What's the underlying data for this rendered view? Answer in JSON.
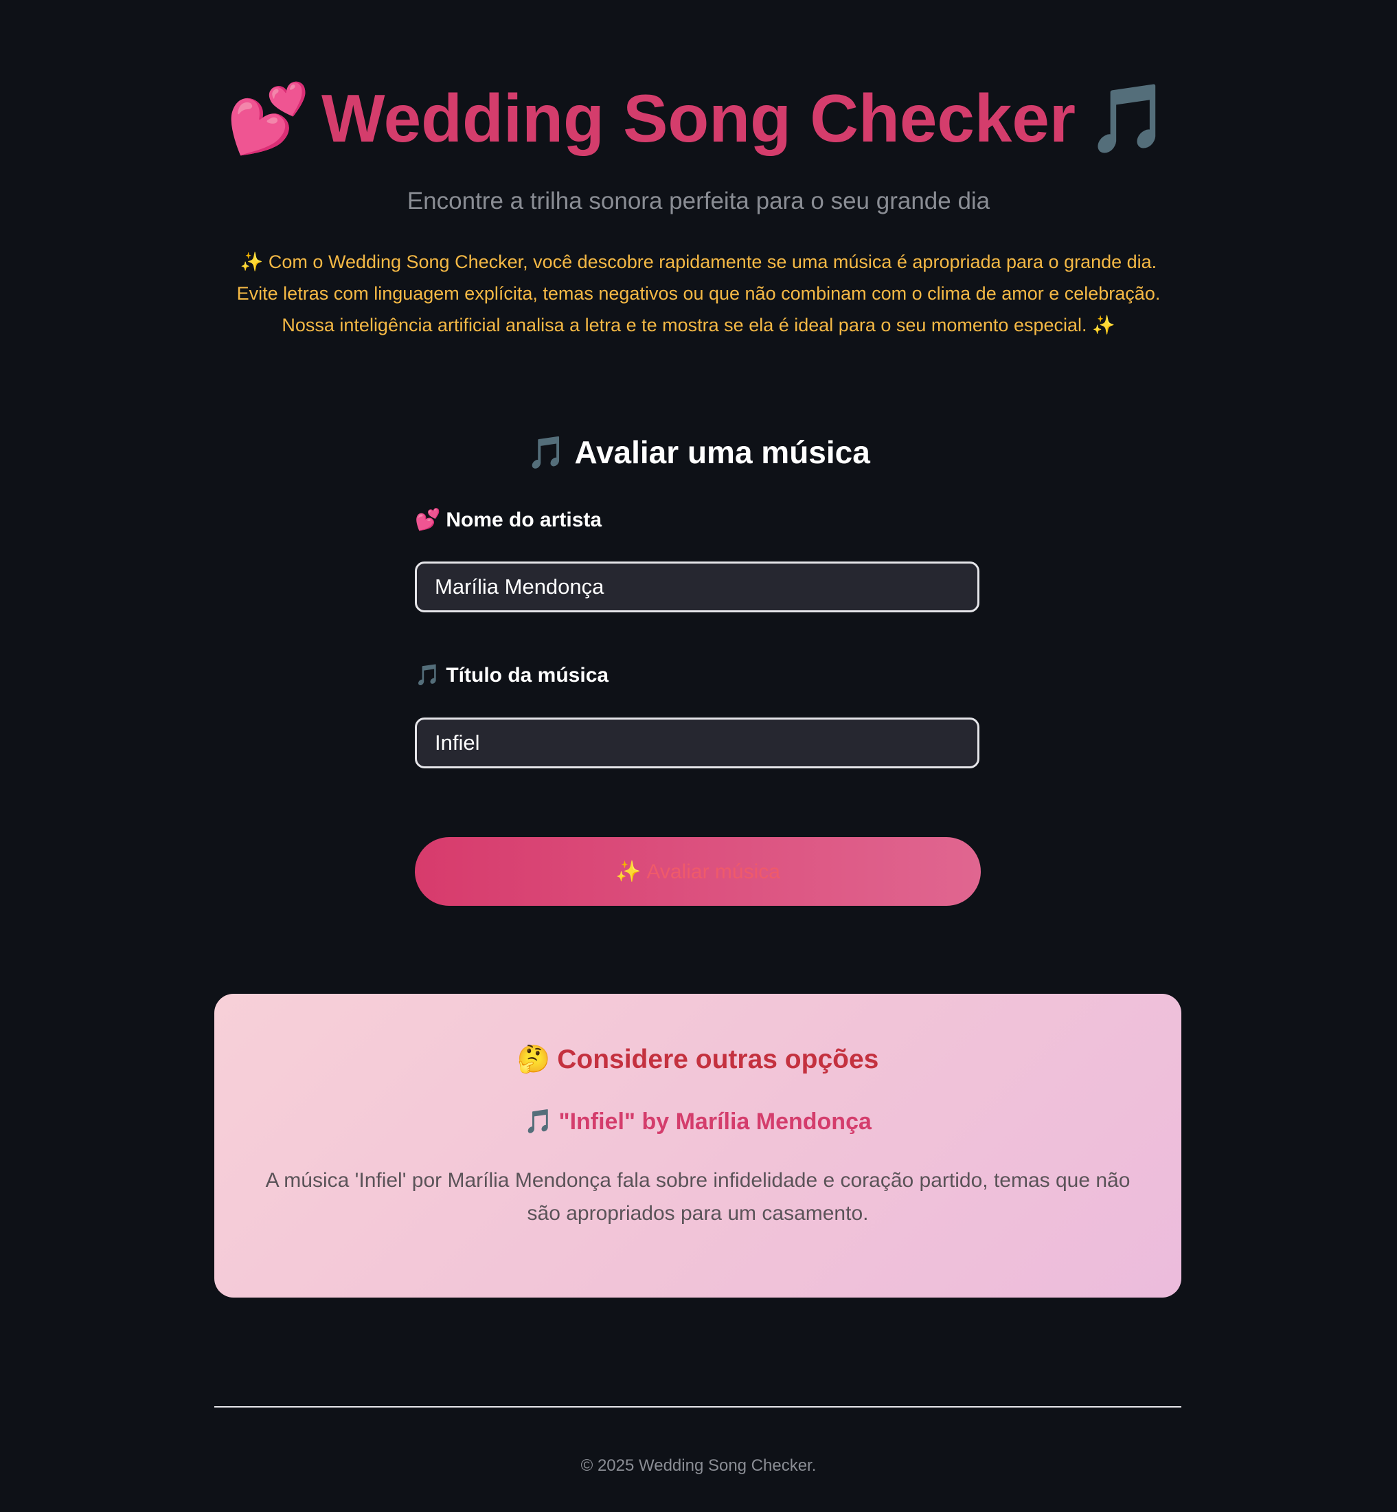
{
  "header": {
    "title_icon_left": "💕",
    "title": "Wedding Song Checker",
    "title_icon_right": "🎵",
    "subtitle": "Encontre a trilha sonora perfeita para o seu grande dia",
    "intro_lines": [
      "✨ Com o Wedding Song Checker, você descobre rapidamente se uma música é apropriada para o grande dia.",
      "Evite letras com linguagem explícita, temas negativos ou que não combinam com o clima de amor e celebração.",
      "Nossa inteligência artificial analisa a letra e te mostra se ela é ideal para o seu momento especial. ✨"
    ]
  },
  "form": {
    "heading_icon": "🎵",
    "heading": "Avaliar uma música",
    "artist_label_icon": "💕",
    "artist_label": "Nome do artista",
    "artist_value": "Marília Mendonça",
    "title_label_icon": "🎵",
    "title_label": "Título da música",
    "title_value": "Infiel",
    "button_icon": "✨",
    "button_label": "Avaliar música"
  },
  "result": {
    "icon": "🤔",
    "title": "Considere outras opções",
    "song_icon": "🎵",
    "song": "\"Infiel\" by Marília Mendonça",
    "description": "A música 'Infiel' por Marília Mendonça fala sobre infidelidade e coração partido, temas que não são apropriados para um casamento."
  },
  "footer": {
    "text": "© 2025 Wedding Song Checker."
  },
  "colors": {
    "background": "#0e1117",
    "accent_pink": "#d43d6c",
    "intro_text": "#f5b945",
    "card_gradient_start": "#f7d0d8",
    "card_gradient_end": "#ecbcdc",
    "result_title": "#c4313f"
  },
  "icons": {
    "title_left": "two-hearts-icon",
    "title_right": "music-notes-icon",
    "sparkles": "sparkles-icon",
    "result": "thinking-face-icon"
  }
}
